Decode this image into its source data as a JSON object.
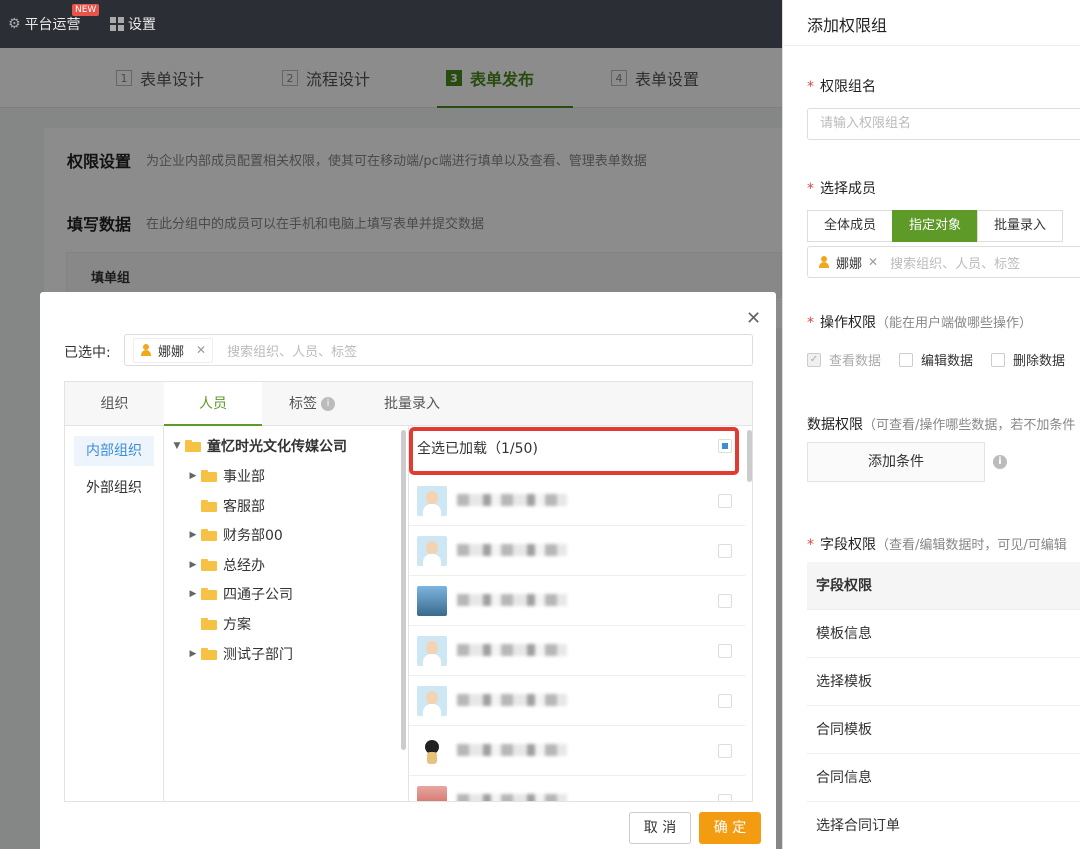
{
  "topbar": {
    "platform_ops": "平台运营",
    "new_badge": "NEW",
    "settings": "设置"
  },
  "steps": [
    {
      "num": "1",
      "label": "表单设计"
    },
    {
      "num": "2",
      "label": "流程设计"
    },
    {
      "num": "3",
      "label": "表单发布"
    },
    {
      "num": "4",
      "label": "表单设置"
    }
  ],
  "page": {
    "perm_title": "权限设置",
    "perm_desc": "为企业内部成员配置相关权限，使其可在移动端/pc端进行填单以及查看、管理表单数据",
    "fill_title": "填写数据",
    "fill_desc": "在此分组中的成员可以在手机和电脑上填写表单并提交数据",
    "fill_group_header": "填单组"
  },
  "modal": {
    "selected_label": "已选中:",
    "selected_chip": "娜娜",
    "search_placeholder": "搜索组织、人员、标签",
    "tabs": [
      "组织",
      "人员",
      "标签",
      "批量录入"
    ],
    "org_types": [
      "内部组织",
      "外部组织"
    ],
    "tree": [
      {
        "label": "童忆时光文化传媒公司",
        "root": true,
        "expanded": true
      },
      {
        "label": "事业部",
        "has_children": true
      },
      {
        "label": "客服部",
        "has_children": false
      },
      {
        "label": "财务部00",
        "has_children": true
      },
      {
        "label": "总经办",
        "has_children": true
      },
      {
        "label": "四通子公司",
        "has_children": true
      },
      {
        "label": "方案",
        "has_children": false
      },
      {
        "label": "测试子部门",
        "has_children": true
      }
    ],
    "select_all_label": "全选已加载（1/50)",
    "cancel": "取 消",
    "ok": "确 定"
  },
  "drawer": {
    "title": "添加权限组",
    "group_name_label": "权限组名",
    "group_name_placeholder": "请输入权限组名",
    "member_label": "选择成员",
    "member_tabs": [
      "全体成员",
      "指定对象",
      "批量录入"
    ],
    "member_chip": "娜娜",
    "member_search_placeholder": "搜索组织、人员、标签",
    "op_label": "操作权限",
    "op_hint": "（能在用户端做哪些操作）",
    "op_checks": [
      "查看数据",
      "编辑数据",
      "删除数据"
    ],
    "data_label": "数据权限",
    "data_hint": "（可查看/操作哪些数据，若不加条件",
    "add_condition": "添加条件",
    "field_label": "字段权限",
    "field_hint": "（查看/编辑数据时，可见/可编辑",
    "field_rows": [
      "字段权限",
      "模板信息",
      "选择模板",
      "合同模板",
      "合同信息",
      "选择合同订单"
    ]
  },
  "colors": {
    "brand_green": "#5d9a27",
    "accent_orange": "#f39c12",
    "highlight_red": "#e23b32",
    "link_blue": "#3c8ed8"
  }
}
